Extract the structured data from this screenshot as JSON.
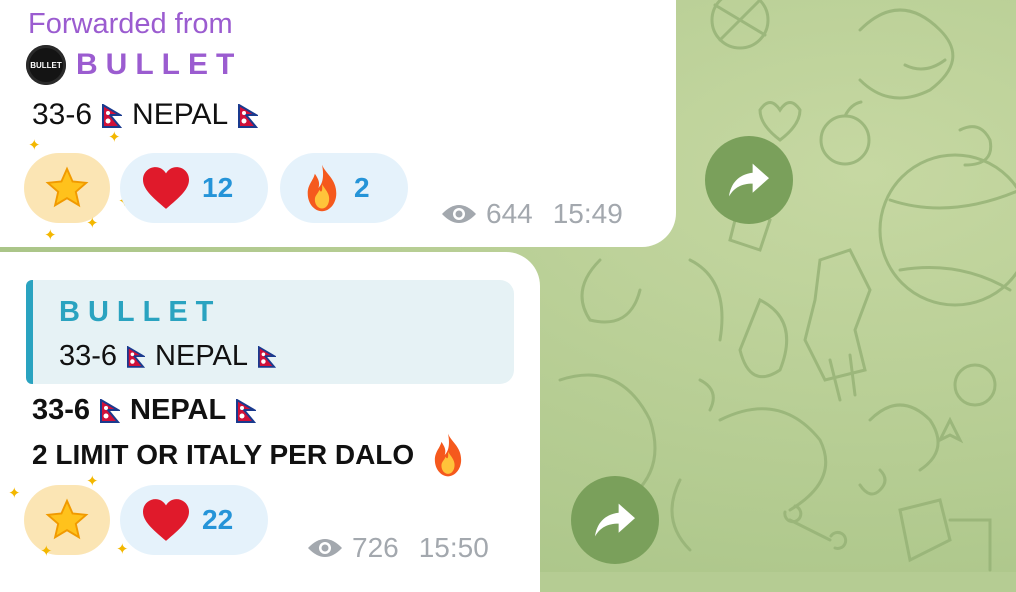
{
  "message1": {
    "forwarded_label": "Forwarded from",
    "channel_name": "BULLET",
    "avatar_text": "BULLET",
    "text_prefix": "33-6",
    "text_word": "NEPAL",
    "reactions": [
      {
        "emoji": "heart",
        "count": "12"
      },
      {
        "emoji": "fire",
        "count": "2"
      }
    ],
    "views": "644",
    "time": "15:49"
  },
  "message2": {
    "reply": {
      "author": "BULLET",
      "text_prefix": "33-6",
      "text_word": "NEPAL"
    },
    "line1_prefix": "33-6",
    "line1_word": "NEPAL",
    "line2": "2 LIMIT OR ITALY PER DALO",
    "reactions": [
      {
        "emoji": "heart",
        "count": "22"
      }
    ],
    "views": "726",
    "time": "15:50"
  },
  "colors": {
    "forward_accent": "#9b5cd0",
    "reply_accent": "#2aa3c0",
    "reaction_count": "#2594d8",
    "share_button": "#7aa05b",
    "wallpaper": "#b5cc93"
  }
}
